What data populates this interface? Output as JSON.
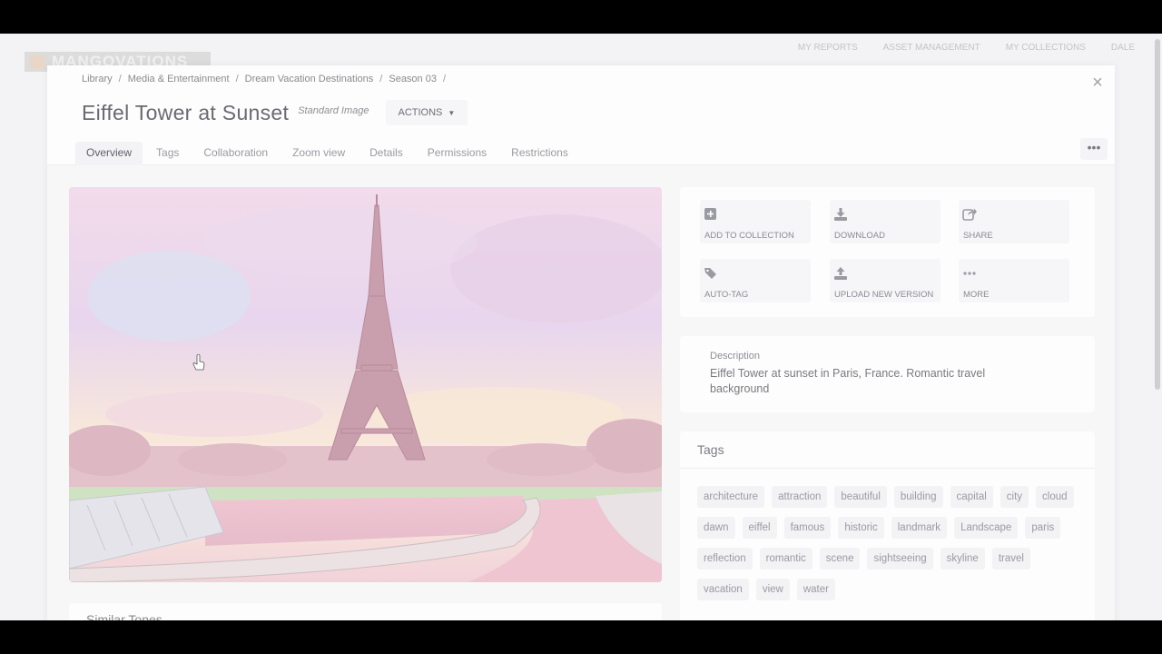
{
  "app": {
    "logo_text": "MANGOVATIONS",
    "nav": [
      "MY REPORTS",
      "ASSET MANAGEMENT",
      "MY COLLECTIONS",
      "DALE"
    ]
  },
  "breadcrumb": [
    "Library",
    "Media & Entertainment",
    "Dream Vacation Destinations",
    "Season 03"
  ],
  "breadcrumb_sep": "/",
  "header": {
    "title": "Eiffel Tower at Sunset",
    "asset_type": "Standard Image",
    "actions_label": "ACTIONS",
    "more_label": "•••",
    "close_label": "×"
  },
  "tabs": [
    {
      "label": "Overview",
      "active": true
    },
    {
      "label": "Tags"
    },
    {
      "label": "Collaboration"
    },
    {
      "label": "Zoom view"
    },
    {
      "label": "Details"
    },
    {
      "label": "Permissions"
    },
    {
      "label": "Restrictions"
    }
  ],
  "quick_actions": [
    {
      "label": "ADD TO COLLECTION",
      "icon": "plus-square-icon"
    },
    {
      "label": "DOWNLOAD",
      "icon": "download-icon"
    },
    {
      "label": "SHARE",
      "icon": "share-icon"
    },
    {
      "label": "AUTO-TAG",
      "icon": "tags-icon"
    },
    {
      "label": "UPLOAD NEW VERSION",
      "icon": "upload-icon"
    },
    {
      "label": "MORE",
      "icon": "ellipsis-icon"
    }
  ],
  "description": {
    "label": "Description",
    "text": "Eiffel Tower at sunset in Paris, France. Romantic travel background"
  },
  "tags": {
    "title": "Tags",
    "items": [
      "architecture",
      "attraction",
      "beautiful",
      "building",
      "capital",
      "city",
      "cloud",
      "dawn",
      "eiffel",
      "famous",
      "historic",
      "landmark",
      "Landscape",
      "paris",
      "reflection",
      "romantic",
      "scene",
      "sightseeing",
      "skyline",
      "travel",
      "vacation",
      "view",
      "water"
    ]
  },
  "similar": {
    "title": "Similar Tones"
  },
  "colors": {
    "accent_text": "#5f5f68",
    "muted_text": "#9a9aa2",
    "card_bg": "#fdfdfd"
  }
}
